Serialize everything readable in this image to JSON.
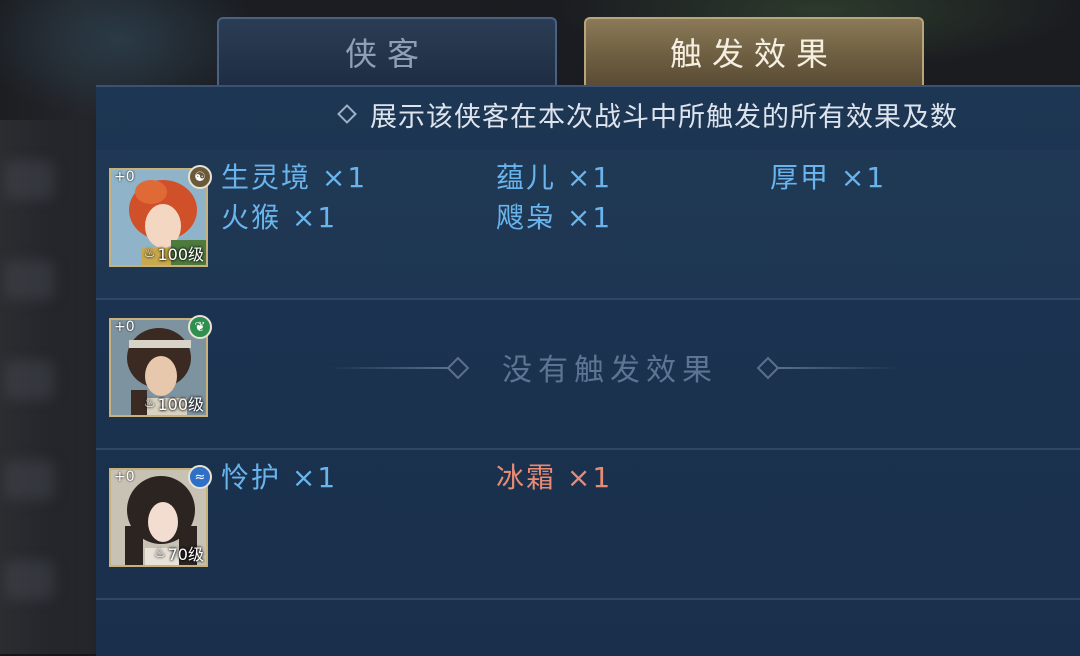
{
  "tabs": [
    {
      "label": "侠客",
      "active": false
    },
    {
      "label": "触发效果",
      "active": true
    }
  ],
  "description": "展示该侠客在本次战斗中所触发的所有效果及数",
  "heroes": [
    {
      "plus": "+0",
      "level": "100级",
      "badge_icon": "yin-yang-icon",
      "effects": [
        {
          "name": "生灵境 ×1",
          "color": "#69b4ec"
        },
        {
          "name": "蕴儿 ×1",
          "color": "#69b4ec"
        },
        {
          "name": "厚甲 ×1",
          "color": "#69b4ec"
        },
        {
          "name": "火猴 ×1",
          "color": "#69b4ec"
        },
        {
          "name": "飕枭 ×1",
          "color": "#69b4ec"
        }
      ]
    },
    {
      "plus": "+0",
      "level": "100级",
      "badge_icon": "leaf-icon",
      "empty_text": "没有触发效果",
      "effects": []
    },
    {
      "plus": "+0",
      "level": "70级",
      "badge_icon": "water-icon",
      "effects": [
        {
          "name": "怜护 ×1",
          "color": "#69b4ec"
        },
        {
          "name": "冰霜 ×1",
          "color": "#e98b74"
        }
      ]
    }
  ],
  "colors": {
    "panel": "#1b3350",
    "effect_blue": "#69b4ec",
    "effect_red": "#e98b74",
    "tab_active": "#6e5f42",
    "avatar_border": "#c9b27a"
  }
}
